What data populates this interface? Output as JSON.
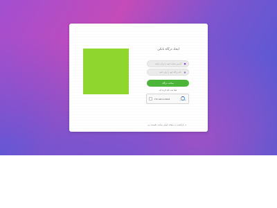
{
  "colors": {
    "background_gradient": [
      "#a24fd0",
      "#c44bb9",
      "#7e55cf",
      "#4a5bd6"
    ],
    "accent_green": "#8fd62f",
    "button_green": "#4bb53a",
    "field_icon": "#8a4ec9"
  },
  "card": {
    "title": "ایجاد درگاه بانکی",
    "fields": [
      {
        "placeholder": "آدرس سایت خود را وارد نمایید",
        "icon": "globe-icon"
      },
      {
        "placeholder": "نام درگاه خود را وارد کنید",
        "icon": "user-icon"
      }
    ],
    "submit_label": "ساخت درگاه",
    "register_text": "قبلا ثبت نام کرده اید",
    "captcha": {
      "label": "I'm not a robot",
      "logo": "recaptcha-icon",
      "sub": "reCAPTCHA"
    },
    "footer_text": "→ بازگشت به صفحه اصلی سایت نکسنت پی"
  }
}
